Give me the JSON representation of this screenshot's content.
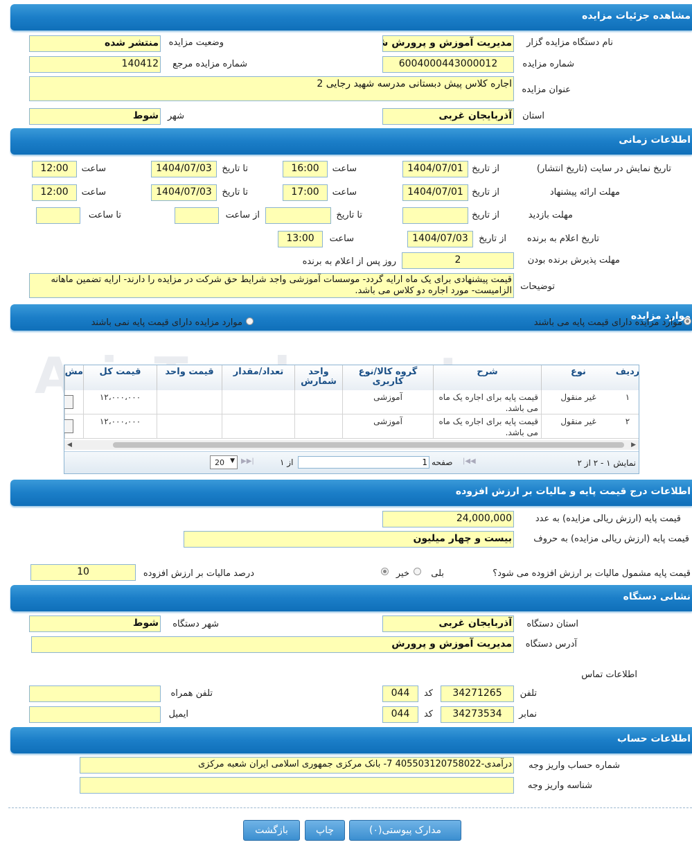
{
  "sections": {
    "details": "مشاهده جزئیات مزایده",
    "time": "اطلاعات زمانی",
    "items": "موارد مزایده",
    "base_price": "اطلاعات درج قیمت پایه و مالیات بر ارزش افزوده",
    "address": "نشانی دستگاه",
    "account": "اطلاعات حساب"
  },
  "details": {
    "org_label": "نام دستگاه مزایده گزار",
    "org": "مدیریت آموزش و پرورش شو",
    "status_label": "وضعیت مزایده",
    "status": "منتشر شده",
    "number_label": "شماره مزایده",
    "number": "6004000443000012",
    "ref_label": "شماره مزایده مرجع",
    "ref": "140412",
    "title_label": "عنوان مزایده",
    "title": "اجاره کلاس پیش دبستانی مدرسه شهید رجایی 2",
    "province_label": "استان",
    "province": "آذربایجان غربی",
    "city_label": "شهر",
    "city": "شوط"
  },
  "time": {
    "publish_label": "تاریخ نمایش در سایت (تاریخ انتشار)",
    "offer_label": "مهلت ارائه پیشنهاد",
    "visit_label": "مهلت بازدید",
    "announce_label": "تاریخ اعلام به برنده",
    "accept_label": "مهلت پذیرش برنده بودن",
    "desc_label": "توضیحات",
    "from_date": "از تاریخ",
    "to_date": "تا تاریخ",
    "hour": "ساعت",
    "from_hour": "از ساعت",
    "to_hour": "تا ساعت",
    "publish_from": "1404/07/01",
    "publish_from_time": "16:00",
    "publish_to": "1404/07/03",
    "publish_to_time": "12:00",
    "offer_from": "1404/07/01",
    "offer_from_time": "17:00",
    "offer_to": "1404/07/03",
    "offer_to_time": "12:00",
    "visit_from": "",
    "visit_to": "",
    "visit_from_time": "",
    "visit_to_time": "",
    "announce_date": "1404/07/03",
    "announce_time": "13:00",
    "accept_days": "2",
    "accept_suffix": "روز پس از اعلام به برنده",
    "description": "قیمت پیشنهادی برای یک ماه ارایه گردد- موسسات آموزشی واجد شرایط حق شرکت در مزایده را دارند- ارایه تضمین ماهانه الزامیست- مورد اجاره دو کلاس می باشد."
  },
  "items": {
    "radio_with_price": "موارد مزایده دارای قیمت پایه می باشند",
    "radio_without_price": "موارد مزایده دارای قیمت پایه نمی باشند",
    "columns": [
      "ردیف",
      "نوع",
      "شرح",
      "گروه کالا/نوع کاربری",
      "واحد شمارش",
      "تعداد/مقدار",
      "قیمت واحد",
      "قیمت کل",
      "مش"
    ],
    "rows": [
      {
        "idx": "۱",
        "type": "غیر منقول",
        "desc": "قیمت پایه برای اجاره یک ماه می باشد.",
        "group": "آموزشی",
        "unit": "",
        "qty": "",
        "unit_price": "",
        "total": "۱۲،۰۰۰،۰۰۰"
      },
      {
        "idx": "۲",
        "type": "غیر منقول",
        "desc": "قیمت پایه برای اجاره یک ماه می باشد.",
        "group": "آموزشی",
        "unit": "",
        "qty": "",
        "unit_price": "",
        "total": "۱۲،۰۰۰،۰۰۰"
      }
    ],
    "pager": {
      "showing": "نمایش ۱ - ۲ از ۲",
      "page_label": "صفحه",
      "page": "1",
      "of": "از ۱",
      "page_size": "20"
    }
  },
  "base_price": {
    "num_label": "قیمت پایه (ارزش ریالی مزایده) به عدد",
    "num": "24,000,000",
    "words_label": "قیمت پایه (ارزش ریالی مزایده) به حروف",
    "words": "بیست و چهار میلیون",
    "vat_question": "قیمت پایه مشمول مالیات بر ارزش افزوده می شود؟",
    "yes": "بلی",
    "no": "خیر",
    "vat_percent_label": "درصد مالیات بر ارزش افزوده",
    "vat_percent": "10"
  },
  "address": {
    "province_label": "استان دستگاه",
    "province": "آذربایجان غربی",
    "city_label": "شهر دستگاه",
    "city": "شوط",
    "addr_label": "آدرس دستگاه",
    "addr": "مدیریت آموزش و پرورش",
    "contact_label": "اطلاعات تماس",
    "phone_label": "تلفن",
    "phone": "34271265",
    "phone_code_label": "کد",
    "phone_code": "044",
    "mobile_label": "تلفن همراه",
    "mobile": "",
    "fax_label": "نمابر",
    "fax": "34273534",
    "fax_code_label": "کد",
    "fax_code": "044",
    "email_label": "ایمیل",
    "email": ""
  },
  "account": {
    "acc_label": "شماره حساب واریز وجه",
    "acc": "درآمدی-405503120758022 7- بانک مرکزی جمهوری اسلامی ایران شعبه مرکزی",
    "id_label": "شناسه واریز وجه",
    "id": ""
  },
  "buttons": {
    "attachments": "مدارک پیوستی(۰)",
    "print": "چاپ",
    "back": "بازگشت"
  },
  "watermark": "AriaTender.net"
}
